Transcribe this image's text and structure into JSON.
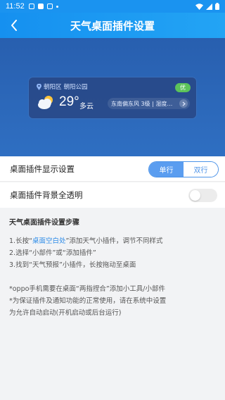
{
  "status_bar": {
    "time": "11:52"
  },
  "header": {
    "title": "天气桌面插件设置"
  },
  "widget": {
    "district": "朝阳区",
    "place": "朝阳公园",
    "aqi": "优",
    "temperature": "29°",
    "condition": "多云",
    "detail": "东南偏东风 3级 | 湿度…"
  },
  "settings": {
    "display_label": "桌面插件显示设置",
    "options": [
      "单行",
      "双行"
    ],
    "selected_option": "单行",
    "transparent_label": "桌面插件背景全透明",
    "transparent_on": false
  },
  "steps": {
    "heading": "天气桌面插件设置步骤",
    "s1_prefix": "1.长按“",
    "s1_highlight": "桌面空白处",
    "s1_suffix": "”添加天气小插件，调节不同样式",
    "s2": "2.选择“小部件”或“添加插件”",
    "s3": "3.找到“天气预报”小插件，长按拖动至桌面",
    "note1": "*oppo手机需要在桌面“两指捏合”添加小工具/小部件",
    "note2": "*为保证插件及通知功能的正常使用，请在系统中设置",
    "note3": "为允许自动启动(开机启动或后台运行)"
  },
  "colors": {
    "primary": "#1a93f0",
    "accent": "#4c93e8",
    "aqi_good": "#5cc35a"
  }
}
